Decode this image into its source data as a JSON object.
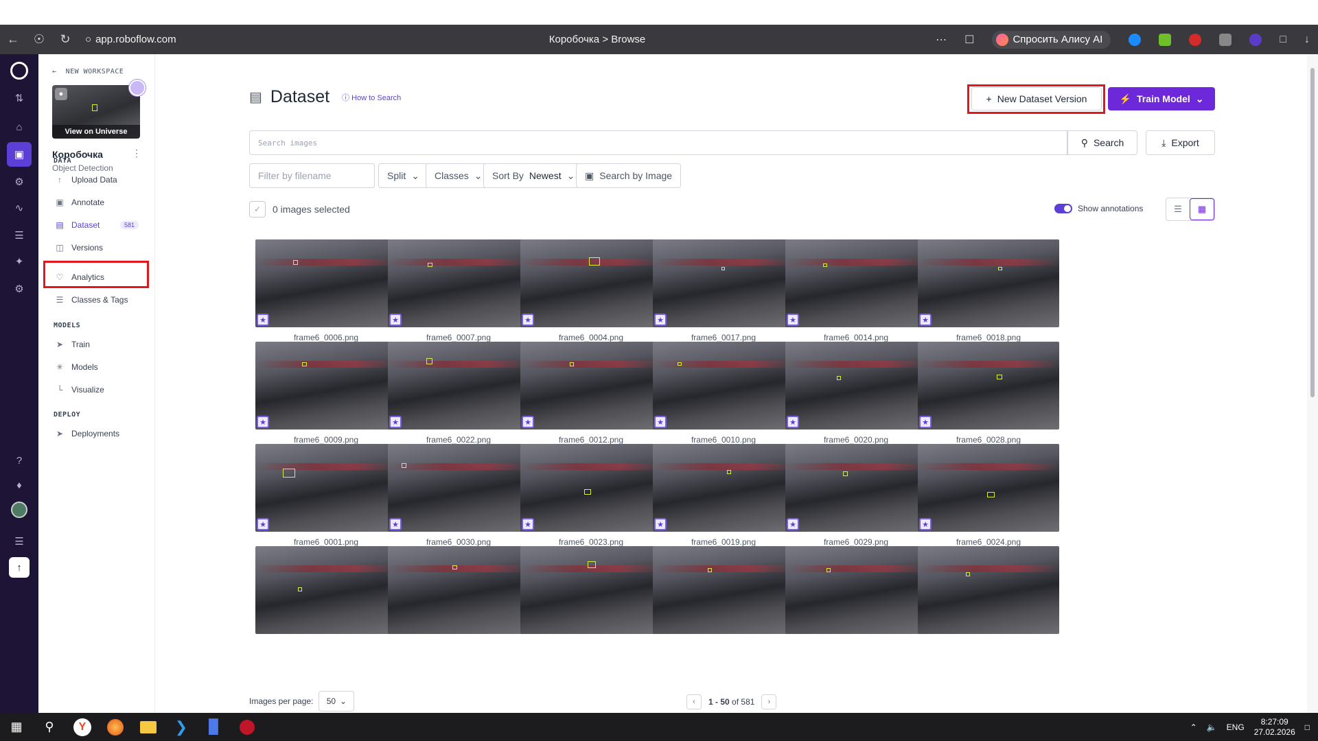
{
  "browser": {
    "url": "app.roboflow.com",
    "tab_title": "Коробочка > Browse",
    "alice_label": "Спросить Алису AI"
  },
  "sidebar": {
    "back_label": "NEW WORKSPACE",
    "view_on_universe": "View on Universe",
    "project_name": "Коробочка",
    "project_type": "Object Detection",
    "sections": {
      "data": "DATA",
      "models": "MODELS",
      "deploy": "DEPLOY"
    },
    "data_items": [
      {
        "label": "Upload Data",
        "icon": "upload-icon"
      },
      {
        "label": "Annotate",
        "icon": "annotate-icon"
      },
      {
        "label": "Dataset",
        "icon": "dataset-icon",
        "count": "581",
        "active": true
      },
      {
        "label": "Versions",
        "icon": "versions-icon"
      }
    ],
    "analytics_items": [
      {
        "label": "Analytics",
        "icon": "analytics-icon"
      },
      {
        "label": "Classes & Tags",
        "icon": "list-icon"
      }
    ],
    "models_items": [
      {
        "label": "Train",
        "icon": "train-icon"
      },
      {
        "label": "Models",
        "icon": "models-icon"
      },
      {
        "label": "Visualize",
        "icon": "chart-icon"
      }
    ],
    "deploy_items": [
      {
        "label": "Deployments",
        "icon": "rocket-icon"
      }
    ]
  },
  "main": {
    "title": "Dataset",
    "how_to_search": "How to Search",
    "new_version_label": "New Dataset Version",
    "train_model_label": "Train Model",
    "search_placeholder": "Search images",
    "search_button": "Search",
    "export_button": "Export",
    "filter_filename_placeholder": "Filter by filename",
    "split_label": "Split",
    "classes_label": "Classes",
    "sort_by_label": "Sort By",
    "sort_by_value": "Newest",
    "search_by_image": "Search by Image",
    "selected_text": "0 images selected",
    "show_annotations": "Show annotations",
    "accent_color": "#6d28d9"
  },
  "images": [
    "frame6_0006.png",
    "frame6_0007.png",
    "frame6_0004.png",
    "frame6_0017.png",
    "frame6_0014.png",
    "frame6_0018.png",
    "frame6_0009.png",
    "frame6_0022.png",
    "frame6_0012.png",
    "frame6_0010.png",
    "frame6_0020.png",
    "frame6_0028.png",
    "frame6_0001.png",
    "frame6_0030.png",
    "frame6_0023.png",
    "frame6_0019.png",
    "frame6_0029.png",
    "frame6_0024.png",
    "",
    "",
    "",
    "",
    "",
    ""
  ],
  "footer": {
    "images_per_page_label": "Images per page:",
    "images_per_page_value": "50",
    "range": "1 - 50",
    "of_label": "of",
    "total": "581"
  },
  "taskbar": {
    "lang": "ENG",
    "time": "8:27:09",
    "date": "27.02.2026"
  }
}
